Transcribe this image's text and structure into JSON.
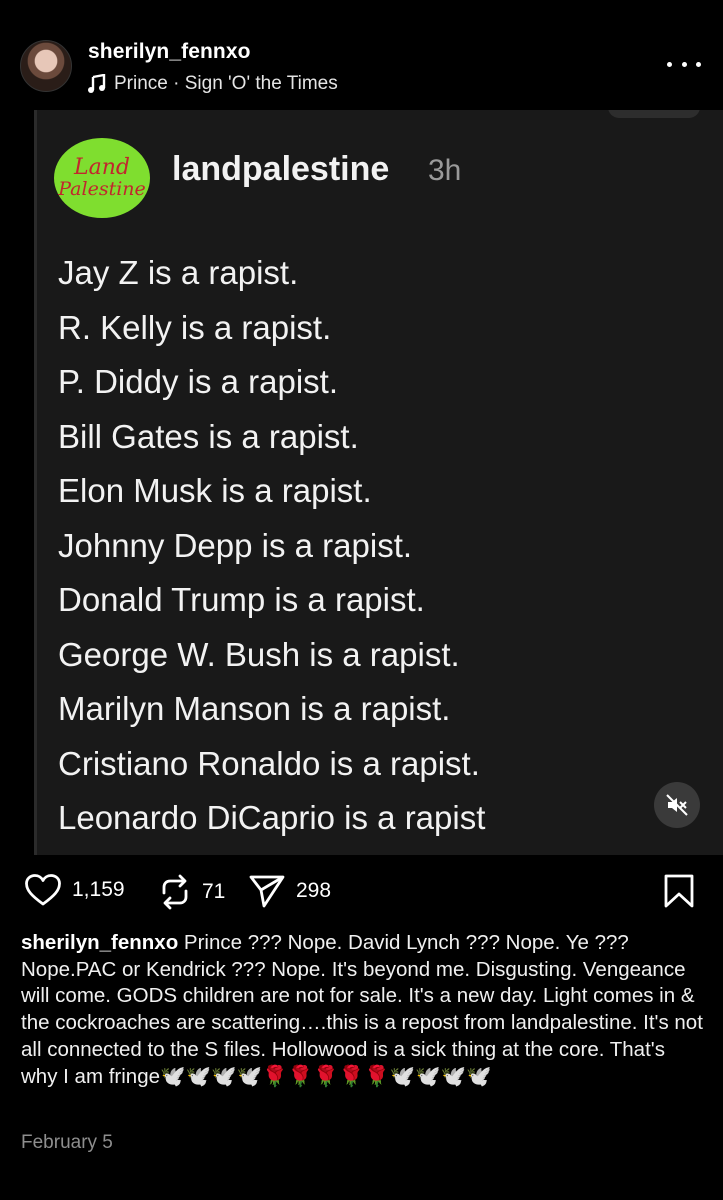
{
  "header": {
    "username": "sherilyn_fennxo",
    "music": "Prince · Sign 'O' the Times"
  },
  "media": {
    "logo_line1": "Land",
    "logo_line2": "Palestine",
    "repost_username": "landpalestine",
    "repost_time": "3h",
    "lines": [
      "Jay Z is a rapist.",
      "R. Kelly is a rapist.",
      "P. Diddy is a rapist.",
      "Bill Gates is a rapist.",
      "Elon Musk is a rapist.",
      "Johnny Depp is a rapist.",
      "Donald Trump is a rapist.",
      "George W. Bush is a rapist.",
      "Marilyn Manson is a rapist.",
      "Cristiano Ronaldo is a rapist.",
      "Leonardo DiCaprio is a rapist"
    ],
    "muted": true
  },
  "actions": {
    "likes": "1,159",
    "reposts": "71",
    "shares": "298"
  },
  "caption": {
    "username": "sherilyn_fennxo",
    "text": "Prince ??? Nope. David Lynch ??? Nope. Ye ??? Nope.PAC or Kendrick ??? Nope. It's beyond me. Disgusting. Vengeance will come. GODS children are not for sale. It's a new day. Light comes in & the cockroaches are scattering….this is a repost from landpalestine. It's not all connected to the S files. Hollowood is a sick thing at the core. That's why I am fringe",
    "emojis": "🕊️🕊️🕊️🕊️🌹🌹🌹🌹🌹🕊️🕊️🕊️🕊️"
  },
  "date": "February 5",
  "icons": [
    "music-note-icon",
    "more-icon",
    "mute-icon",
    "heart-icon",
    "repost-icon",
    "share-icon",
    "bookmark-icon"
  ]
}
